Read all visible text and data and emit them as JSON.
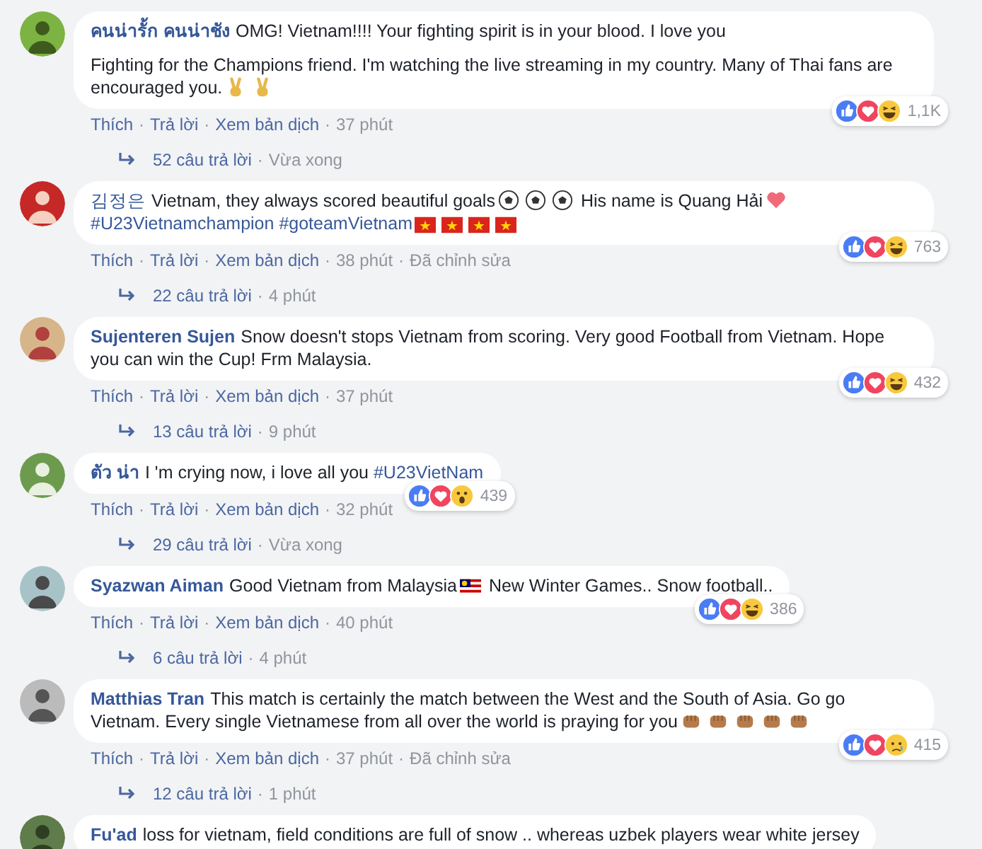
{
  "separator": "·",
  "comments": [
    {
      "author": "คนน่ารั้ก คนน่าชัง",
      "paragraphs": [
        [
          {
            "kind": "text",
            "text": "OMG! Vietnam!!!! Your fighting spirit is in your blood. I love you"
          }
        ],
        [
          {
            "kind": "text",
            "text": "Fighting for the Champions friend. I'm watching the live streaming in my country. Many of Thai fans are encouraged you."
          },
          {
            "kind": "victory"
          },
          {
            "kind": "victory"
          }
        ]
      ],
      "actions": [
        "Thích",
        "Trả lời",
        "Xem bản dịch"
      ],
      "time": "37 phút",
      "reactions": [
        {
          "kind": "like"
        },
        {
          "kind": "love"
        },
        {
          "kind": "haha"
        }
      ],
      "reaction_count": "1,1K",
      "replies": "52 câu trả lời",
      "replies_time": "Vừa xong"
    },
    {
      "author": "김정은",
      "author_plain": true,
      "paragraphs": [
        [
          {
            "kind": "text",
            "text": "Vietnam, they always scored beautiful goals"
          },
          {
            "kind": "ball"
          },
          {
            "kind": "ball"
          },
          {
            "kind": "ball"
          },
          {
            "kind": "text",
            "text": "His name is Quang Hải"
          },
          {
            "kind": "heart"
          },
          {
            "kind": "tag",
            "text": "#U23Vietnamchampion"
          },
          {
            "kind": "tag",
            "text": "#goteamVietnam"
          },
          {
            "kind": "flag-vn"
          },
          {
            "kind": "flag-vn"
          },
          {
            "kind": "flag-vn"
          },
          {
            "kind": "flag-vn"
          }
        ]
      ],
      "actions": [
        "Thích",
        "Trả lời",
        "Xem bản dịch"
      ],
      "time": "38 phút",
      "edited": "Đã chỉnh sửa",
      "reactions": [
        {
          "kind": "like"
        },
        {
          "kind": "love"
        },
        {
          "kind": "haha"
        }
      ],
      "reaction_count": "763",
      "replies": "22 câu trả lời",
      "replies_time": "4 phút"
    },
    {
      "author": "Sujenteren Sujen",
      "paragraphs": [
        [
          {
            "kind": "text",
            "text": "Snow doesn't stops Vietnam from scoring. Very good Football from Vietnam. Hope you can win the Cup! Frm Malaysia."
          }
        ]
      ],
      "actions": [
        "Thích",
        "Trả lời",
        "Xem bản dịch"
      ],
      "time": "37 phút",
      "reactions": [
        {
          "kind": "like"
        },
        {
          "kind": "love"
        },
        {
          "kind": "haha"
        }
      ],
      "reaction_count": "432",
      "replies": "13 câu trả lời",
      "replies_time": "9 phút"
    },
    {
      "author": "ตัว น่า",
      "paragraphs": [
        [
          {
            "kind": "text",
            "text": "I 'm crying now, i love all you"
          },
          {
            "kind": "tag",
            "text": "#U23VietNam"
          }
        ]
      ],
      "actions": [
        "Thích",
        "Trả lời",
        "Xem bản dịch"
      ],
      "time": "32 phút",
      "reactions": [
        {
          "kind": "like"
        },
        {
          "kind": "love"
        },
        {
          "kind": "wow"
        }
      ],
      "reaction_count": "439",
      "replies": "29 câu trả lời",
      "replies_time": "Vừa xong"
    },
    {
      "author": "Syazwan Aiman",
      "paragraphs": [
        [
          {
            "kind": "text",
            "text": "Good Vietnam from Malaysia"
          },
          {
            "kind": "flag-my"
          },
          {
            "kind": "text",
            "text": "New Winter Games.. Snow football.."
          }
        ]
      ],
      "actions": [
        "Thích",
        "Trả lời",
        "Xem bản dịch"
      ],
      "time": "40 phút",
      "reactions": [
        {
          "kind": "like"
        },
        {
          "kind": "love"
        },
        {
          "kind": "haha"
        }
      ],
      "reaction_count": "386",
      "replies": "6 câu trả lời",
      "replies_time": "4 phút"
    },
    {
      "author": "Matthias Tran",
      "paragraphs": [
        [
          {
            "kind": "text",
            "text": "This match is certainly the match between the West and the South of Asia. Go go Vietnam. Every single Vietnamese from all over the world is praying for you"
          },
          {
            "kind": "fist"
          },
          {
            "kind": "fist"
          },
          {
            "kind": "fist"
          },
          {
            "kind": "fist"
          },
          {
            "kind": "fist"
          }
        ]
      ],
      "actions": [
        "Thích",
        "Trả lời",
        "Xem bản dịch"
      ],
      "time": "37 phút",
      "edited": "Đã chỉnh sửa",
      "reactions": [
        {
          "kind": "like"
        },
        {
          "kind": "love"
        },
        {
          "kind": "sad"
        }
      ],
      "reaction_count": "415",
      "replies": "12 câu trả lời",
      "replies_time": "1 phút"
    },
    {
      "author": "Fu'ad",
      "paragraphs": [
        [
          {
            "kind": "text",
            "text": "loss for vietnam, field conditions are full of snow .. whereas uzbek players wear white jersey"
          }
        ]
      ]
    }
  ]
}
